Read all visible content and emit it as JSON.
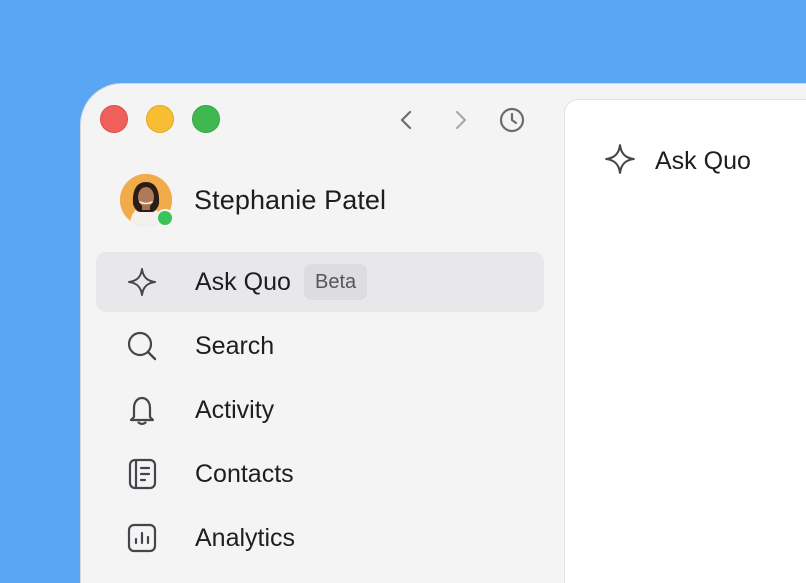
{
  "profile": {
    "name": "Stephanie Patel",
    "status": "online"
  },
  "nav": {
    "back_icon": "chevron-left-icon",
    "forward_icon": "chevron-right-icon",
    "history_icon": "clock-icon"
  },
  "menu": [
    {
      "label": "Ask Quo",
      "badge": "Beta",
      "icon": "sparkle-icon",
      "active": true
    },
    {
      "label": "Search",
      "icon": "search-icon",
      "active": false
    },
    {
      "label": "Activity",
      "icon": "bell-icon",
      "active": false
    },
    {
      "label": "Contacts",
      "icon": "contacts-book-icon",
      "active": false
    },
    {
      "label": "Analytics",
      "icon": "analytics-icon",
      "active": false
    }
  ],
  "panel": {
    "title": "Ask Quo",
    "icon": "sparkle-icon"
  },
  "colors": {
    "desktop": "#5aa6f5",
    "sidebar": "#f4f4f5",
    "active_item": "#e8e8ea",
    "online": "#3ac35a"
  }
}
